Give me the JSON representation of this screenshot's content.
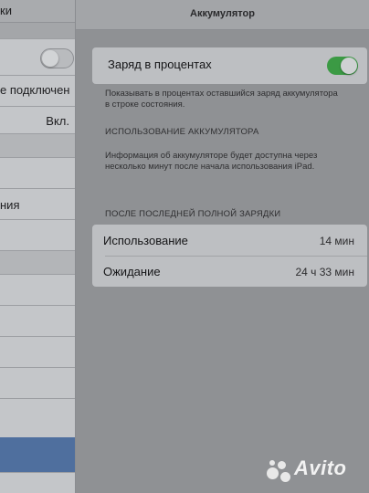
{
  "left_panel": {
    "title_fragment": "ки",
    "not_connected": "е подключен",
    "value_on": "Вкл.",
    "item_fragment": "ния"
  },
  "nav": {
    "title": "Аккумулятор"
  },
  "percent": {
    "label": "Заряд в процентах",
    "enabled": true,
    "footer": "Показывать в процентах оставшийся заряд аккумулятора в строке состояния."
  },
  "usage_section": {
    "header": "ИСПОЛЬЗОВАНИЕ АККУМУЛЯТОРА",
    "info": "Информация об аккумуляторе будет доступна через несколько минут после начала использования iPad."
  },
  "since_full": {
    "header": "ПОСЛЕ ПОСЛЕДНЕЙ ПОЛНОЙ ЗАРЯДКИ",
    "rows": [
      {
        "label": "Использование",
        "value": "14 мин"
      },
      {
        "label": "Ожидание",
        "value": "24 ч 33 мин"
      }
    ]
  },
  "watermark": {
    "text": "Avito"
  },
  "colors": {
    "toggle_on": "#3b9a44",
    "blue_cell": "#4f6f9e"
  }
}
